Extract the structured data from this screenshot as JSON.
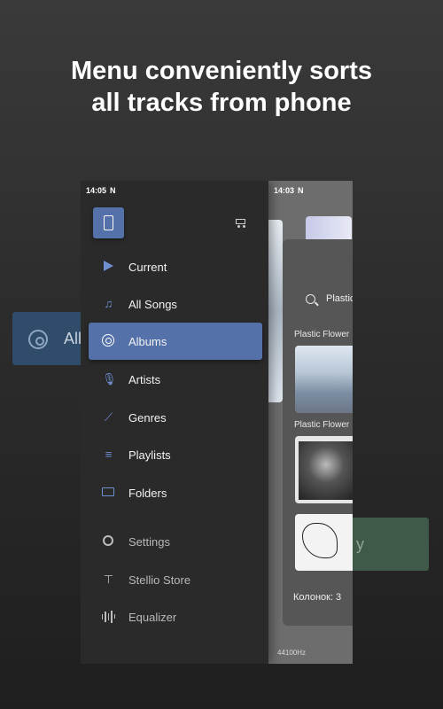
{
  "headline": {
    "line1": "Menu conveniently sorts",
    "line2": "all tracks from phone"
  },
  "ghost": {
    "left_text": "All",
    "right_text": "y"
  },
  "drawer": {
    "status_time": "14:05",
    "status_icon": "N",
    "device_icon": "phone-icon",
    "cart_icon": "cart-icon",
    "items": [
      {
        "label": "Current",
        "icon": "play-icon",
        "active": false
      },
      {
        "label": "All Songs",
        "icon": "music-note-icon",
        "active": false
      },
      {
        "label": "Albums",
        "icon": "disc-icon",
        "active": true
      },
      {
        "label": "Artists",
        "icon": "microphone-icon",
        "active": false
      },
      {
        "label": "Genres",
        "icon": "guitar-icon",
        "active": false
      },
      {
        "label": "Playlists",
        "icon": "playlist-icon",
        "active": false
      },
      {
        "label": "Folders",
        "icon": "folder-icon",
        "active": false
      }
    ],
    "secondary_items": [
      {
        "label": "Settings",
        "icon": "gear-icon"
      },
      {
        "label": "Stellio Store",
        "icon": "paint-roller-icon"
      },
      {
        "label": "Equalizer",
        "icon": "equalizer-icon"
      }
    ]
  },
  "behind": {
    "status_time": "14:03",
    "status_icon": "N",
    "search_text": "Plastic",
    "album1_label": "Plastic Flower",
    "album2_label": "Plastic Flower",
    "columns_text": "Колонок: 3",
    "sample_rate": "44100Hz"
  },
  "colors": {
    "accent": "#5472a9",
    "drawer_bg": "#2a2a2b",
    "icon_blue": "#6f8fd0"
  }
}
